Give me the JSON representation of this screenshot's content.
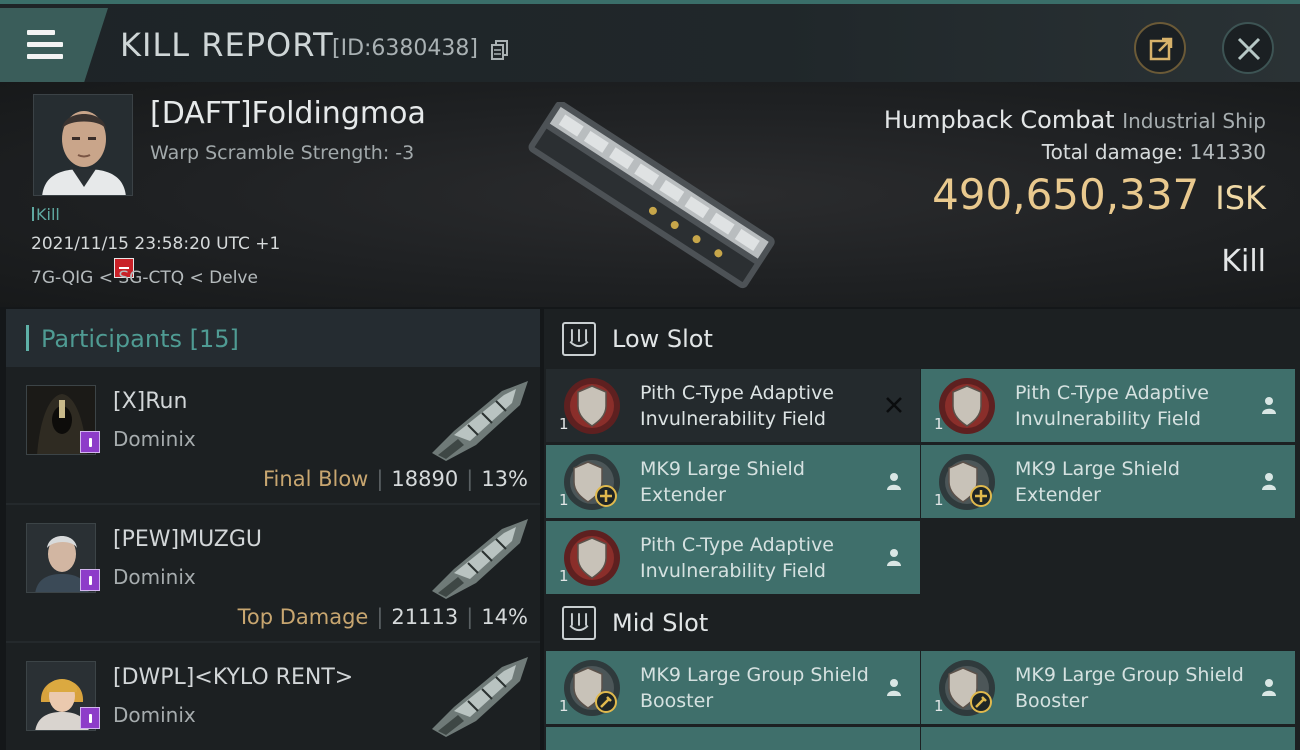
{
  "header": {
    "title": "KILL REPORT",
    "report_id": "[ID:6380438]"
  },
  "summary": {
    "pilot_name": "[DAFT]Foldingmoa",
    "warp_scramble": "Warp Scramble Strength: -3",
    "tag": "Kill",
    "timestamp": "2021/11/15 23:58:20 UTC +1",
    "location": "7G-QIG < SG-CTQ < Delve",
    "ship_name": "Humpback Combat",
    "ship_class": "Industrial Ship",
    "damage_label": "Total damage:",
    "damage_value": "141330",
    "isk_value": "490,650,337",
    "isk_unit": "ISK",
    "result": "Kill"
  },
  "participants": {
    "title": "Participants [15]",
    "rows": [
      {
        "name": "[X]Run",
        "ship": "Dominix",
        "label": "Final Blow",
        "damage": "18890",
        "percent": "13%"
      },
      {
        "name": "[PEW]MUZGU",
        "ship": "Dominix",
        "label": "Top Damage",
        "damage": "21113",
        "percent": "14%"
      },
      {
        "name": "[DWPL]<KYLO RENT>",
        "ship": "Dominix"
      }
    ]
  },
  "slots": {
    "low": {
      "title": "Low Slot",
      "items": [
        {
          "qty": "1",
          "name": "Pith C-Type Adaptive Invulnerability Field",
          "status": "destroyed"
        },
        {
          "qty": "1",
          "name": "Pith C-Type Adaptive Invulnerability Field",
          "status": "dropped"
        },
        {
          "qty": "1",
          "name": "MK9 Large Shield Extender",
          "status": "dropped"
        },
        {
          "qty": "1",
          "name": "MK9 Large Shield Extender",
          "status": "dropped"
        },
        {
          "qty": "1",
          "name": "Pith C-Type Adaptive Invulnerability Field",
          "status": "dropped"
        }
      ]
    },
    "mid": {
      "title": "Mid Slot",
      "items": [
        {
          "qty": "1",
          "name": "MK9 Large Group Shield Booster",
          "status": "dropped"
        },
        {
          "qty": "1",
          "name": "MK9 Large Group Shield Booster",
          "status": "dropped"
        }
      ]
    }
  },
  "colors": {
    "accent": "#5fb1a8",
    "isk_gold": "#e9c98e",
    "item_dropped_bg": "#3f6f6b",
    "badge_purple": "#8d3cc9",
    "badge_red": "#c92128"
  },
  "icons": {
    "menu": "hamburger-menu-icon",
    "copy": "copy-icon",
    "share": "share-icon",
    "close": "close-icon",
    "slot": "slot-icon",
    "destroyed": "x-icon",
    "dropped": "person-icon"
  }
}
